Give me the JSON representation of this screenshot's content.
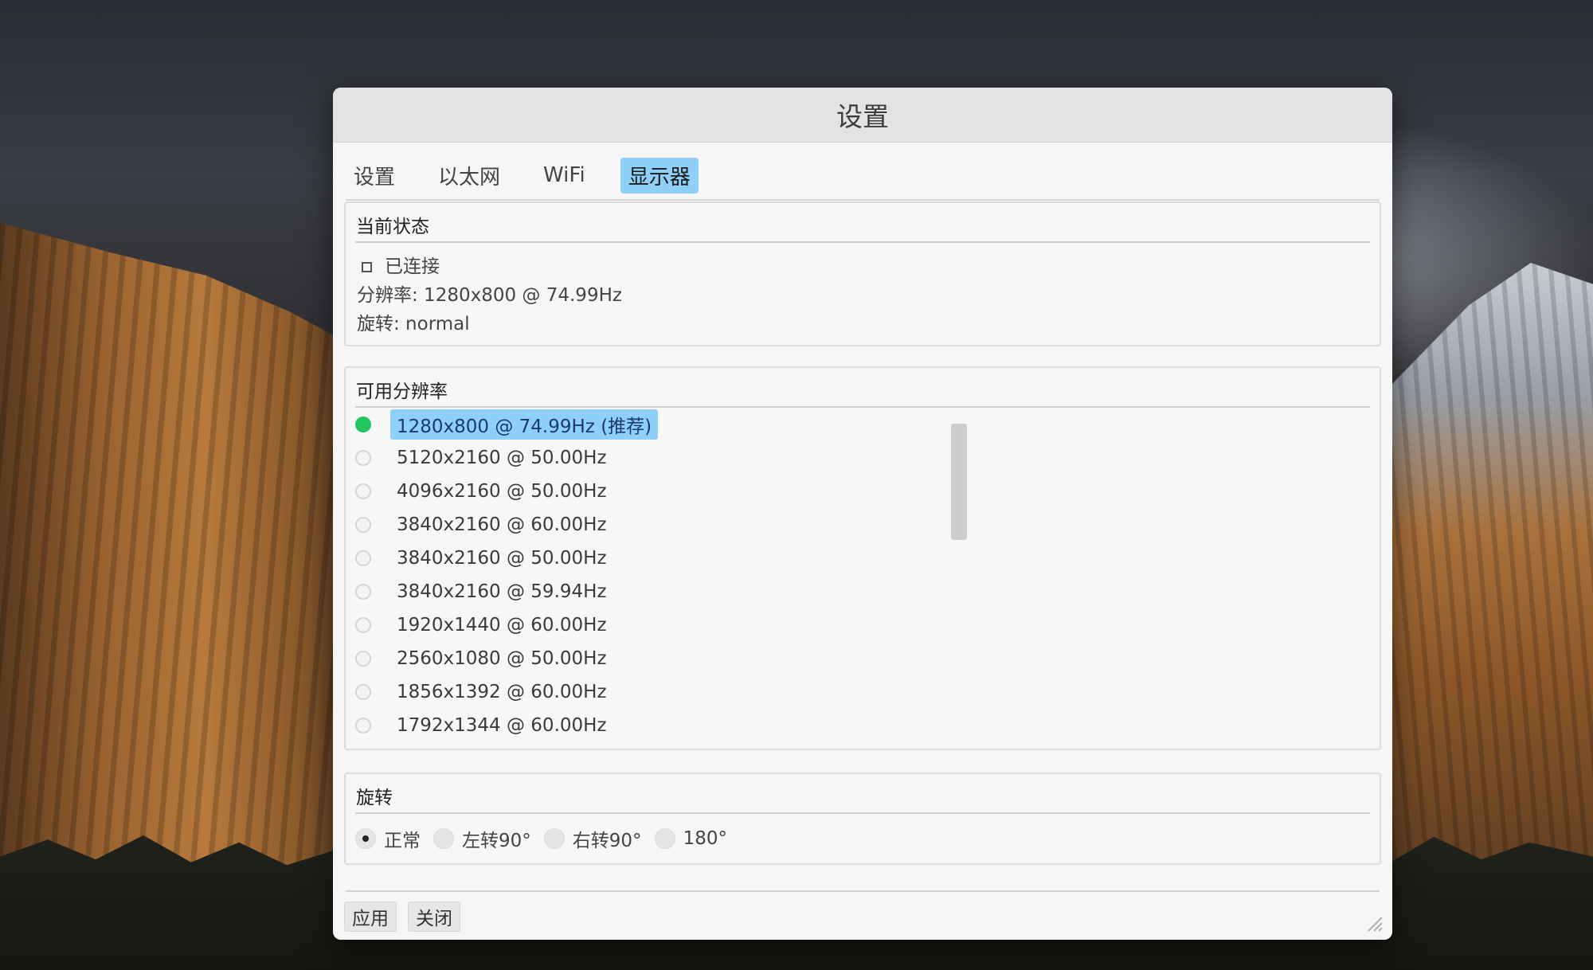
{
  "window": {
    "title": "设置"
  },
  "tabs": [
    {
      "label": "设置",
      "active": false
    },
    {
      "label": "以太网",
      "active": false
    },
    {
      "label": "WiFi",
      "active": false
    },
    {
      "label": "显示器",
      "active": true
    }
  ],
  "status": {
    "title": "当前状态",
    "connected": "已连接",
    "resolution": "分辨率: 1280x800 @ 74.99Hz",
    "rotation": "旋转: normal"
  },
  "resolutions": {
    "title": "可用分辨率",
    "items": [
      {
        "label": "1280x800 @ 74.99Hz (推荐)",
        "selected": true
      },
      {
        "label": "5120x2160 @ 50.00Hz",
        "selected": false
      },
      {
        "label": "4096x2160 @ 50.00Hz",
        "selected": false
      },
      {
        "label": "3840x2160 @ 60.00Hz",
        "selected": false
      },
      {
        "label": "3840x2160 @ 50.00Hz",
        "selected": false
      },
      {
        "label": "3840x2160 @ 59.94Hz",
        "selected": false
      },
      {
        "label": "1920x1440 @ 60.00Hz",
        "selected": false
      },
      {
        "label": "2560x1080 @ 50.00Hz",
        "selected": false
      },
      {
        "label": "1856x1392 @ 60.00Hz",
        "selected": false
      },
      {
        "label": "1792x1344 @ 60.00Hz",
        "selected": false
      }
    ]
  },
  "rotation": {
    "title": "旋转",
    "options": [
      {
        "label": "正常",
        "checked": true
      },
      {
        "label": "左转90°",
        "checked": false
      },
      {
        "label": "右转90°",
        "checked": false
      },
      {
        "label": "180°",
        "checked": false
      }
    ]
  },
  "buttons": {
    "apply": "应用",
    "close": "关闭"
  },
  "colors": {
    "accent": "#8fd0f8",
    "selected_indicator": "#22c55e"
  }
}
